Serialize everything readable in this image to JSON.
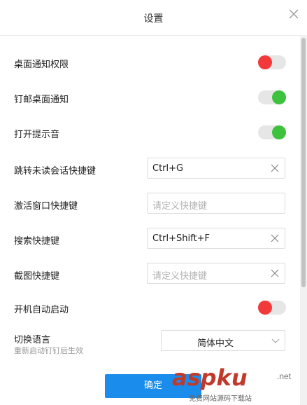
{
  "dialog": {
    "title": "设置"
  },
  "settings": {
    "desktop_notify": {
      "label": "桌面通知权限",
      "enabled": false
    },
    "pin_notify": {
      "label": "钉邮桌面通知",
      "enabled": true
    },
    "sound": {
      "label": "打开提示音",
      "enabled": true
    },
    "jump_unread": {
      "label": "跳转未读会话快捷键",
      "value": "Ctrl+G"
    },
    "activate_window": {
      "label": "激活窗口快捷键",
      "placeholder": "请定义快捷键"
    },
    "search": {
      "label": "搜索快捷键",
      "value": "Ctrl+Shift+F"
    },
    "screenshot": {
      "label": "截图快捷键",
      "placeholder": "请定义快捷键"
    },
    "autostart": {
      "label": "开机自动启动",
      "enabled": false
    },
    "language": {
      "label": "切换语言",
      "sublabel": "重新启动钉钉后生效",
      "value": "简体中文"
    }
  },
  "footer": {
    "confirm_label": "确定"
  },
  "watermark": {
    "main": "aspku",
    "net": ".net",
    "sub": "免费网站源码下载站"
  },
  "colors": {
    "accent": "#1a8ceb",
    "toggle_on": "#3cc23c",
    "toggle_off_knob": "#f23a3a"
  },
  "icons": {
    "close": "close-icon",
    "clear": "clear-icon",
    "dropdown": "chevron-down-icon"
  }
}
